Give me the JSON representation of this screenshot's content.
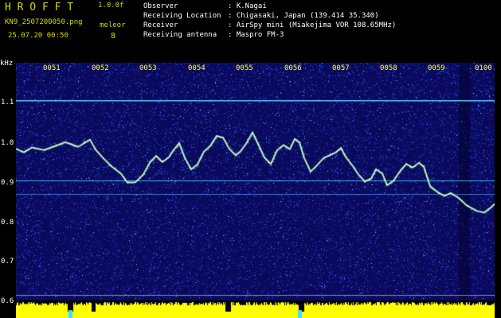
{
  "header": {
    "logo": "H R O F F T",
    "version": "1.0.0f",
    "filename": "KN9_2507200050.png",
    "datetime": "25.07.20 00:50",
    "program": "meleor",
    "count": "8",
    "info": [
      {
        "label": "Observer",
        "value": ": K.Nagai"
      },
      {
        "label": "Receiving Location",
        "value": ": Chigasaki, Japan (139.414 35.340)"
      },
      {
        "label": "Receiver",
        "value": ": AirSpy mini (Miakejima VOR 108.65MHz)"
      },
      {
        "label": "Receiving antenna",
        "value": ": Maspro FM-3"
      }
    ]
  },
  "plot": {
    "y_unit": "kHz",
    "y_ticks": [
      "1.1",
      "1.0",
      "0.9",
      "0.8",
      "0.7",
      "0.6"
    ],
    "x_ticks": [
      "0051",
      "0052",
      "0053",
      "0054",
      "0055",
      "0056",
      "0057",
      "0058",
      "0059",
      "0100"
    ],
    "colors": {
      "background": "#0a0a5c",
      "noise": "#2a3cff",
      "signal_line": "#40d0ff",
      "trace": "#d0ffd0",
      "bottom_bar": "#ffff00"
    }
  }
}
